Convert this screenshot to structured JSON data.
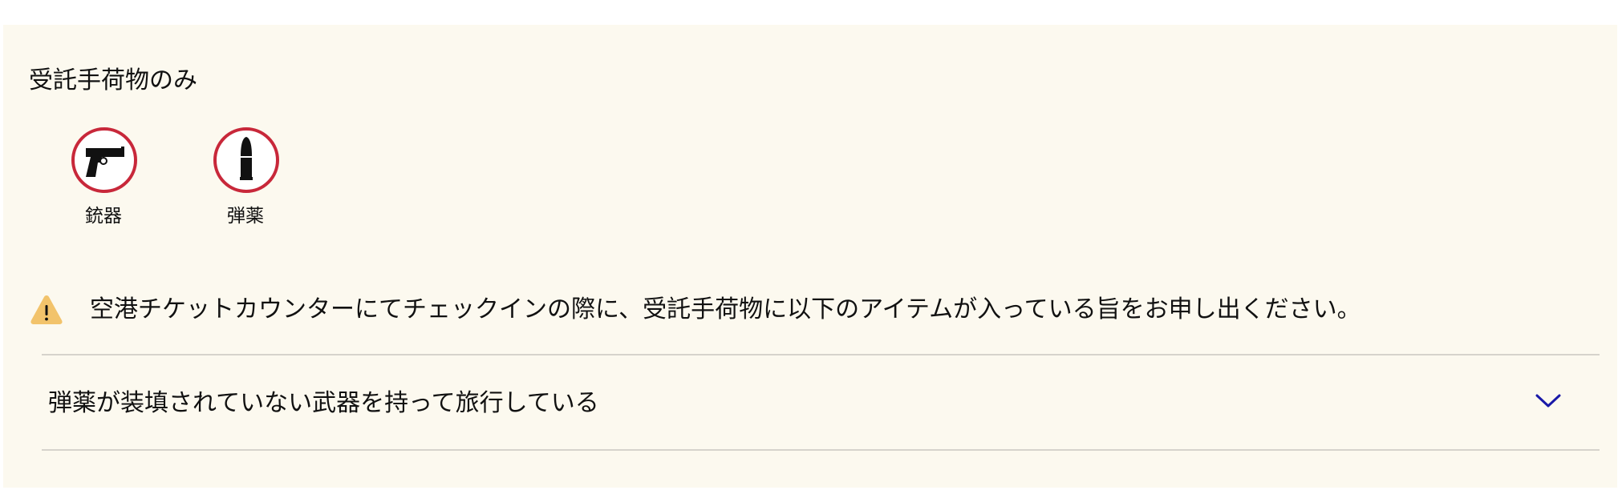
{
  "section": {
    "title": "受託手荷物のみ"
  },
  "items": [
    {
      "label": "銃器",
      "icon": "handgun-icon",
      "status": "prohibited"
    },
    {
      "label": "弾薬",
      "icon": "bullet-icon",
      "status": "prohibited"
    }
  ],
  "notice": {
    "icon": "warning-icon",
    "text": "空港チケットカウンターにてチェックインの際に、受託手荷物に以下のアイテムが入っている旨をお申し出ください。"
  },
  "accordion": {
    "title": "弾薬が装填されていない武器を持って旅行している",
    "expanded": false
  },
  "colors": {
    "panel_background": "#fcf9ef",
    "prohibited_ring": "#c8283a",
    "warning": "#f2c36b",
    "chevron": "#1a1aa8",
    "divider": "#d6d3cc"
  }
}
